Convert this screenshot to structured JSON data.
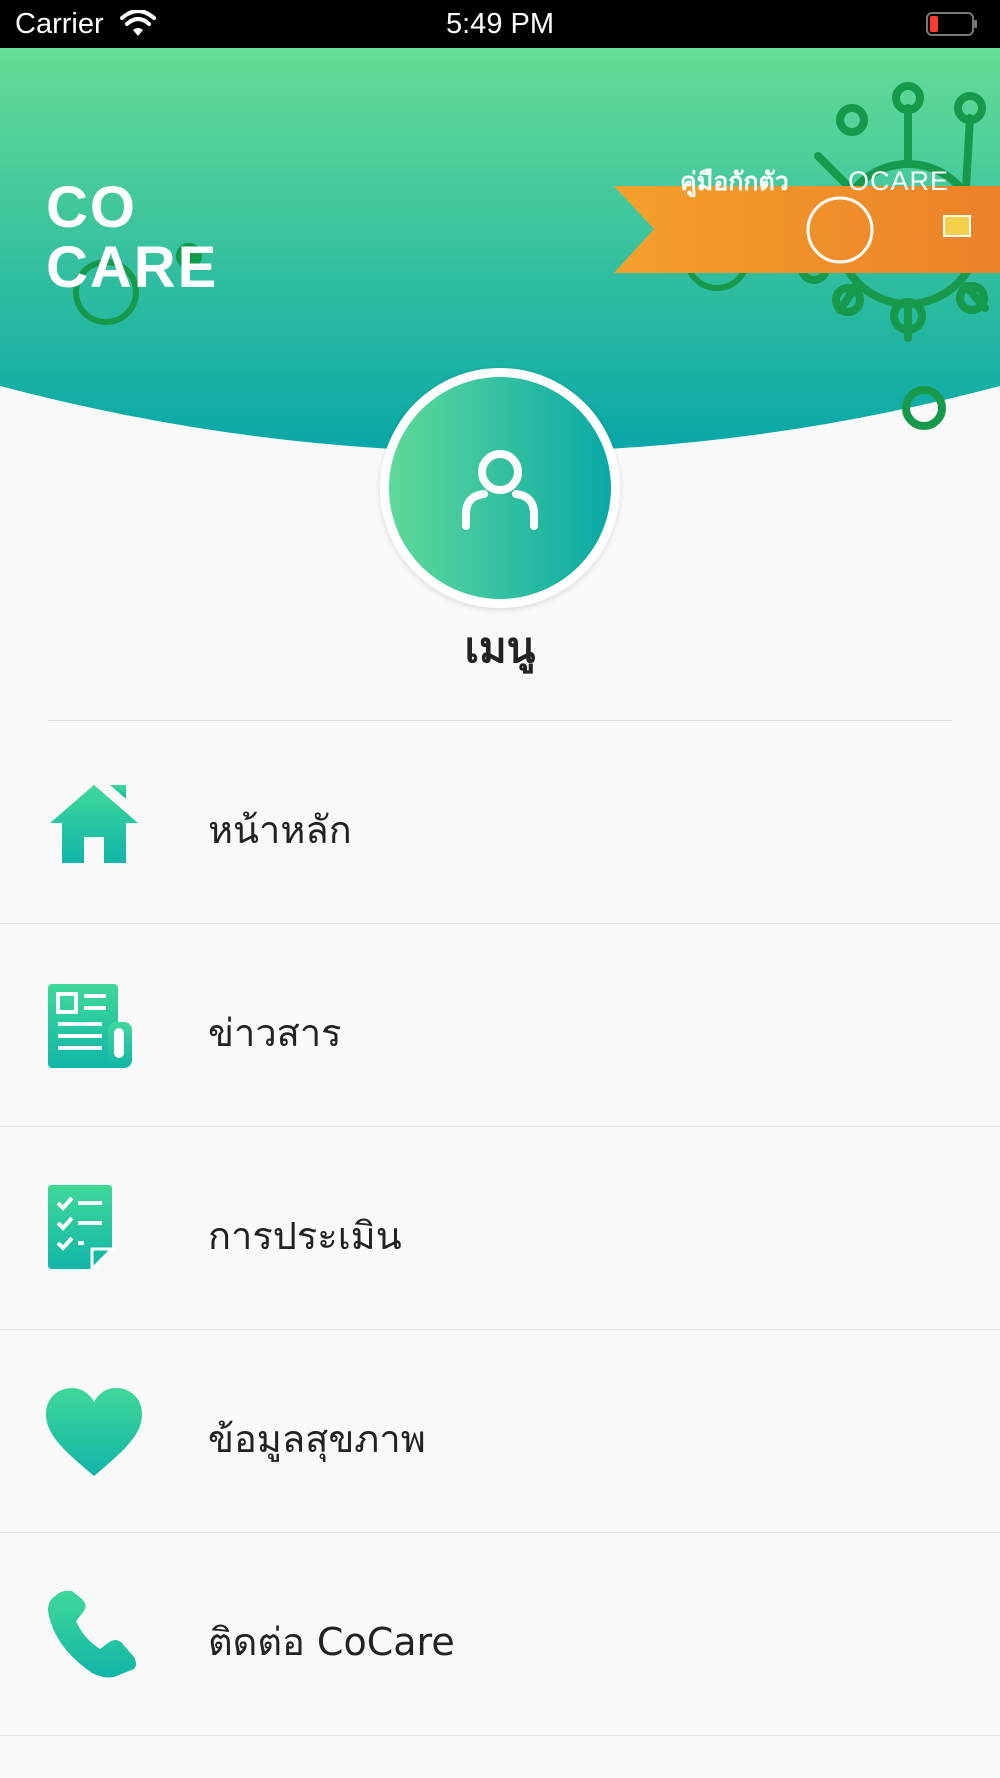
{
  "status_bar": {
    "carrier": "Carrier",
    "time": "5:49 PM",
    "wifi_icon": "wifi-icon",
    "battery_icon": "battery-low-icon"
  },
  "header": {
    "logo_line1": "CO",
    "logo_line2": "CARE",
    "banner_text": "คู่มือกักตัว",
    "banner_brand": "OCARE",
    "gradient_top": "#66dc95",
    "gradient_bottom": "#0aa8a8",
    "banner_color": "#ef8a2a"
  },
  "avatar": {
    "icon": "user-icon"
  },
  "menu": {
    "title": "เมนู",
    "items": [
      {
        "label": "หน้าหลัก",
        "icon": "home-icon"
      },
      {
        "label": "ข่าวสาร",
        "icon": "newspaper-icon"
      },
      {
        "label": "การประเมิน",
        "icon": "checklist-icon"
      },
      {
        "label": "ข้อมูลสุขภาพ",
        "icon": "heart-icon"
      },
      {
        "label": "ติดต่อ CoCare",
        "icon": "phone-icon"
      }
    ]
  },
  "colors": {
    "icon_gradient_top": "#3fd89a",
    "icon_gradient_bottom": "#12b5a8",
    "virus_green": "#16a04a"
  }
}
